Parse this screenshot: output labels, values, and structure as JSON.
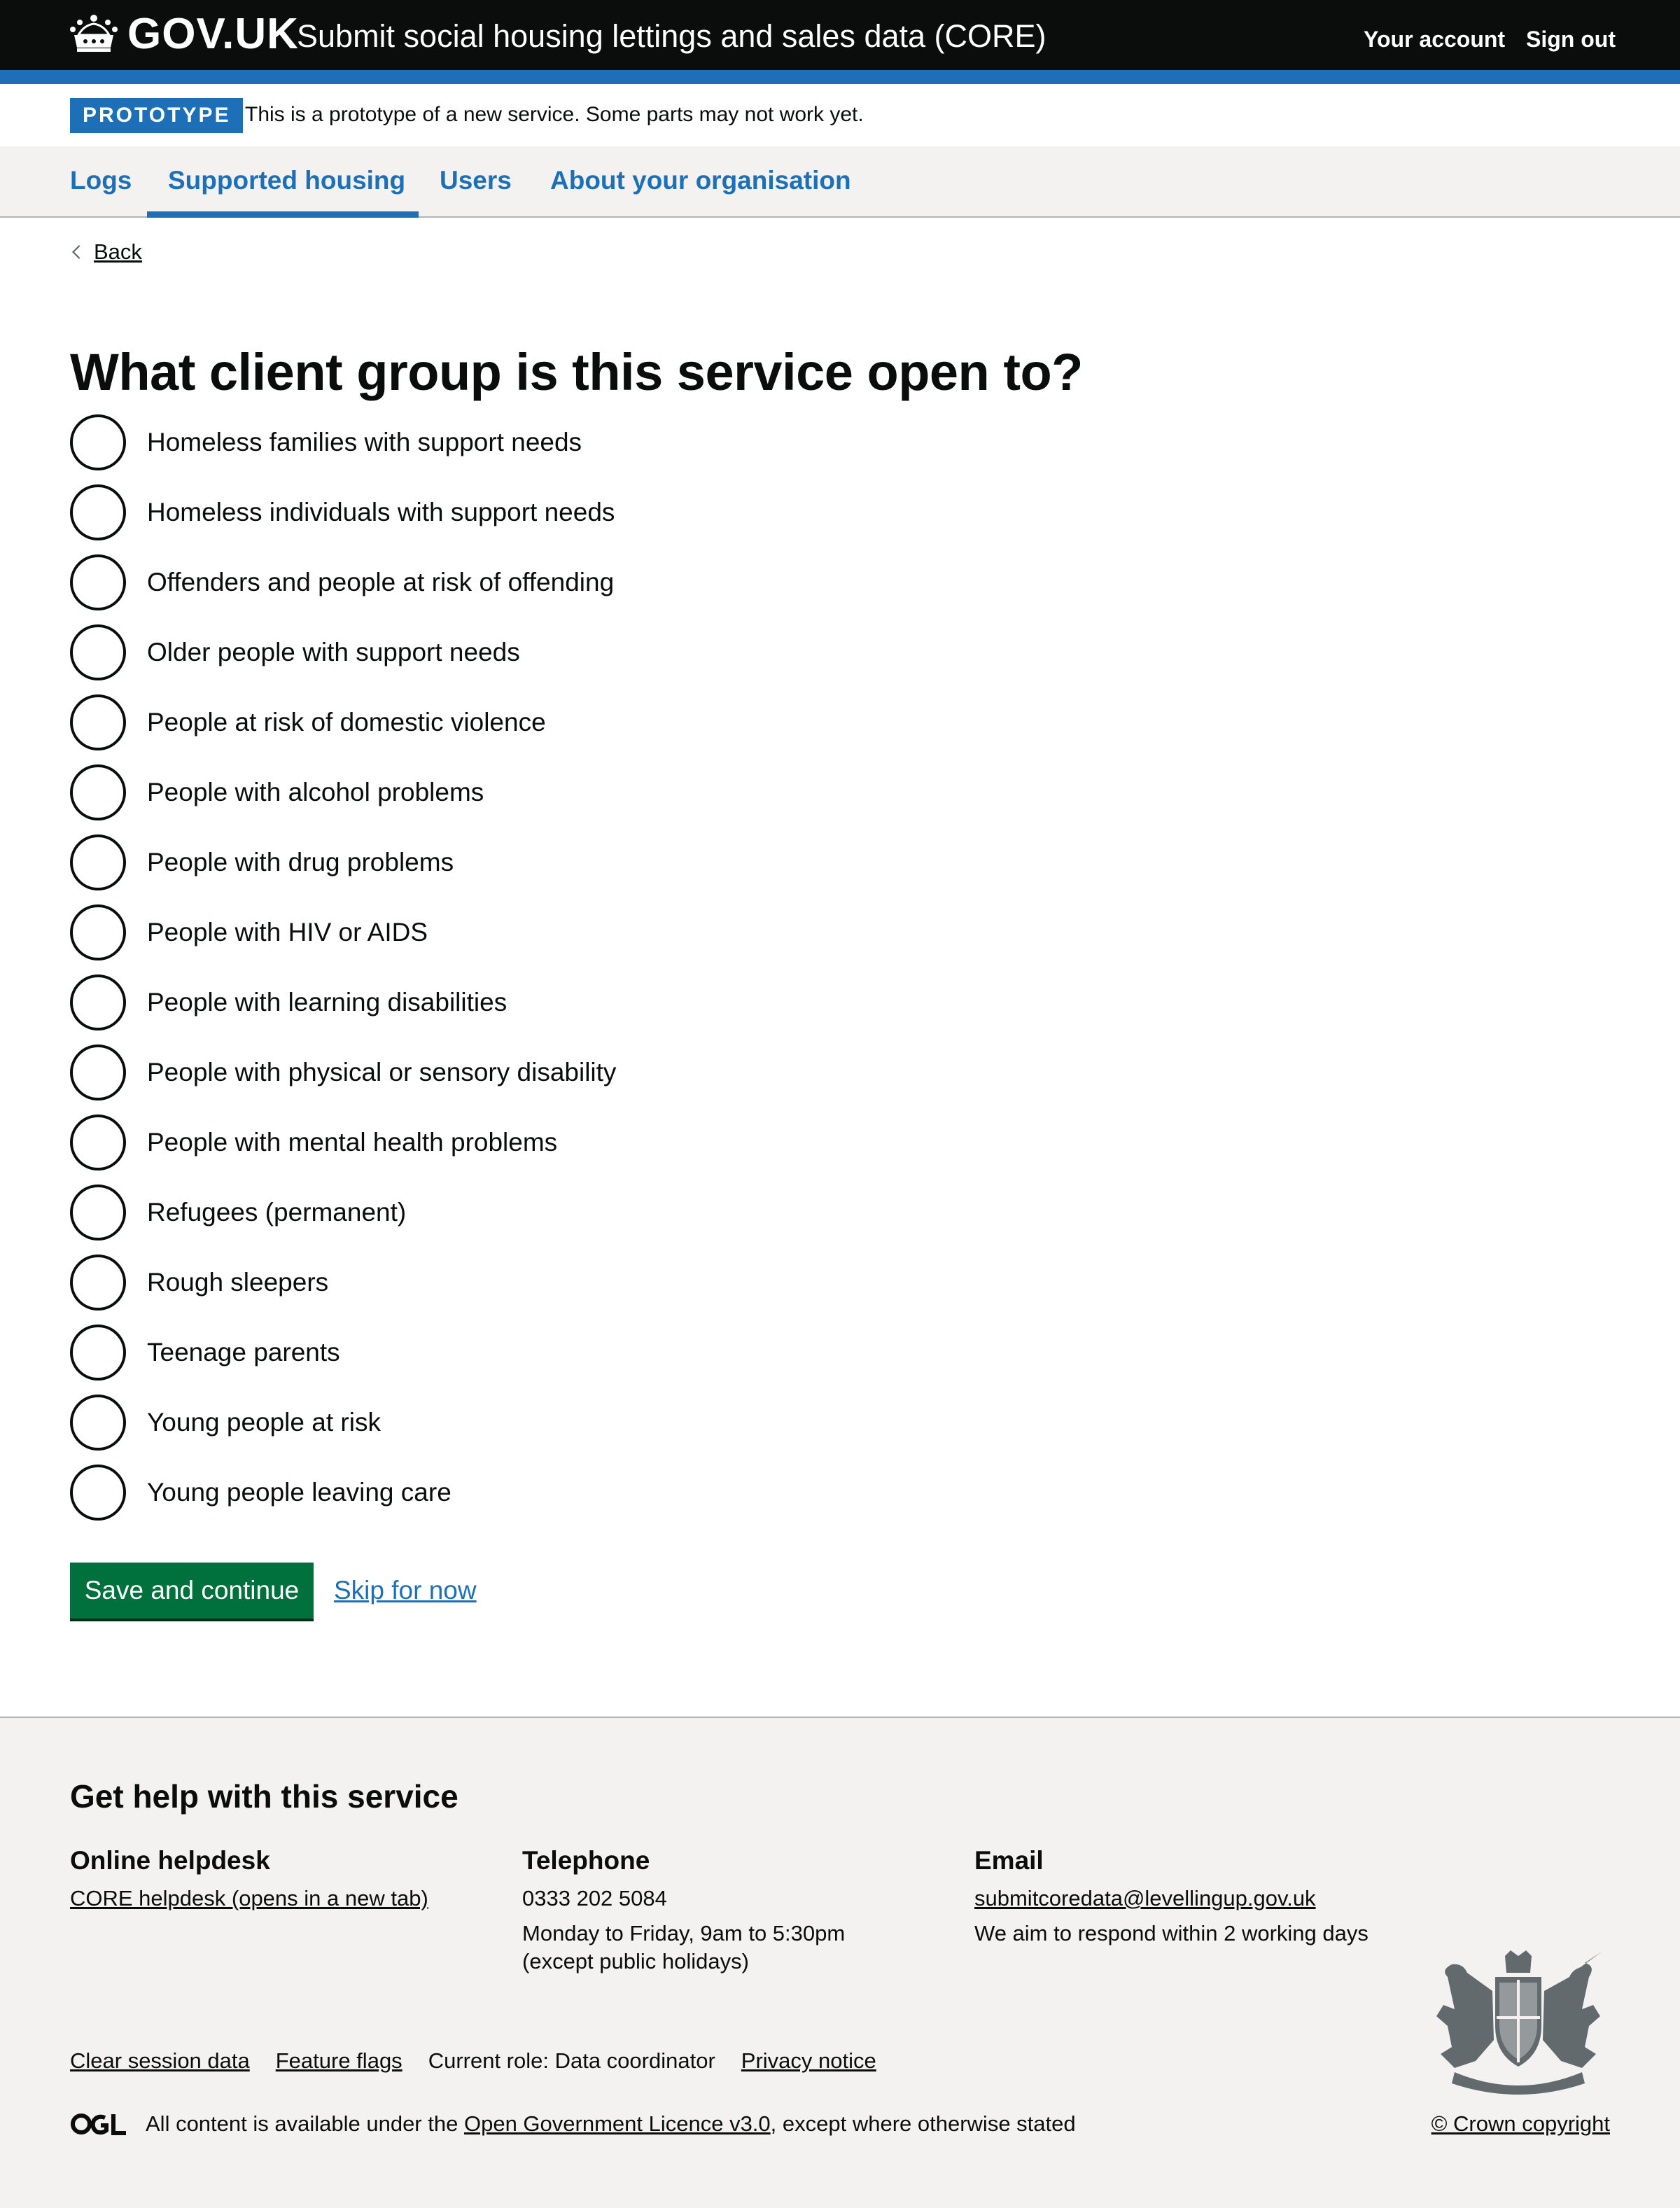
{
  "header": {
    "logo_text": "GOV.UK",
    "service_name": "Submit social housing lettings and sales data (CORE)",
    "account_link": "Your account",
    "signout_link": "Sign out"
  },
  "phase_banner": {
    "tag": "PROTOTYPE",
    "text": "This is a prototype of a new service. Some parts may not work yet."
  },
  "nav": {
    "items": [
      "Logs",
      "Supported housing",
      "Users",
      "About your organisation"
    ],
    "active": "Supported housing"
  },
  "back_link": "Back",
  "question": {
    "heading": "What client group is this service open to?",
    "options": [
      "Homeless families with support needs",
      "Homeless individuals with support needs",
      "Offenders and people at risk of offending",
      "Older people with support needs",
      "People at risk of domestic violence",
      "People with alcohol problems",
      "People with drug problems",
      "People with HIV or AIDS",
      "People with learning disabilities",
      "People with physical or sensory disability",
      "People with mental health problems",
      "Refugees (permanent)",
      "Rough sleepers",
      "Teenage parents",
      "Young people at risk",
      "Young people leaving care"
    ]
  },
  "actions": {
    "save_label": "Save and continue",
    "skip_label": "Skip for now"
  },
  "footer": {
    "title": "Get help with this service",
    "helpdesk": {
      "heading": "Online helpdesk",
      "link": "CORE helpdesk (opens in a new tab)"
    },
    "telephone": {
      "heading": "Telephone",
      "number": "0333 202 5084",
      "hours_line1": "Monday to Friday, 9am to 5:30pm",
      "hours_line2": "(except public holidays)"
    },
    "email": {
      "heading": "Email",
      "address": "submitcoredata@levellingup.gov.uk",
      "note": "We aim to respond within 2 working days"
    },
    "meta_links": {
      "clear_session": "Clear session data",
      "feature_flags": "Feature flags",
      "current_role": "Current role: Data coordinator",
      "privacy": "Privacy notice"
    },
    "licence": {
      "prefix": "All content is available under the",
      "link": "Open Government Licence v3.0",
      "suffix": ", except where otherwise stated"
    },
    "copyright": "© Crown copyright"
  },
  "colors": {
    "header_bg": "#0b0c0c",
    "brand_blue": "#1d70b8",
    "button_green": "#00703c",
    "footer_bg": "#f3f2f1"
  }
}
